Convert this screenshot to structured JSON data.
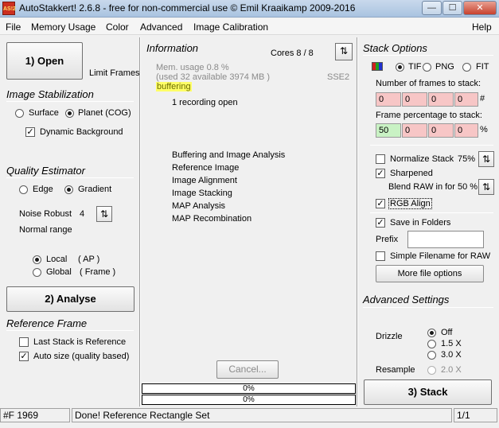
{
  "window": {
    "app_icon_text": "AS!2",
    "title": "AutoStakkert! 2.6.8 - free for non-commercial use © Emil Kraaikamp 2009-2016",
    "min_glyph": "—",
    "max_glyph": "☐",
    "close_glyph": "✕"
  },
  "menu": [
    "File",
    "Memory Usage",
    "Color",
    "Advanced",
    "Image Calibration",
    "Help"
  ],
  "left": {
    "open_label": "1) Open",
    "limit_frames": "Limit Frames",
    "stabilization_title": "Image Stabilization",
    "surface_label": "Surface",
    "planet_label": "Planet (COG)",
    "dynamic_bg_label": "Dynamic Background",
    "quality_title": "Quality Estimator",
    "edge_label": "Edge",
    "gradient_label": "Gradient",
    "noise_robust_label": "Noise Robust",
    "noise_robust_value": "4",
    "normal_range": "Normal range",
    "local_label": "Local",
    "local_ap": "( AP )",
    "global_label": "Global",
    "global_frame": "( Frame )",
    "analyse_label": "2) Analyse",
    "reference_title": "Reference Frame",
    "last_stack_label": "Last Stack is Reference",
    "auto_size_label": "Auto size (quality based)"
  },
  "middle": {
    "info_title": "Information",
    "cores": "Cores 8 / 8",
    "mem_usage": "Mem. usage 0.8 %",
    "mem_available": "(used 32 available 3974 MB )",
    "sse": "SSE2",
    "buffering": "buffering",
    "recording_open": "1 recording open",
    "steps": [
      "Buffering and Image Analysis",
      "Reference Image",
      "Image Alignment",
      "Image Stacking",
      "MAP Analysis",
      "MAP Recombination"
    ],
    "cancel_label": "Cancel...",
    "progress1": "0%",
    "progress2": "0%"
  },
  "right": {
    "stack_title": "Stack Options",
    "tif_label": "TIF",
    "png_label": "PNG",
    "fit_label": "FIT",
    "frames_label": "Number of frames to stack:",
    "frames_values": [
      "0",
      "0",
      "0",
      "0"
    ],
    "frames_suffix": "#",
    "pct_label": "Frame percentage to stack:",
    "pct_values": [
      "50",
      "0",
      "0",
      "0"
    ],
    "pct_suffix": "%",
    "normalize_label": "Normalize Stack",
    "normalize_value": "75%",
    "sharpened_label": "Sharpened",
    "blend_label": "Blend RAW in for",
    "blend_value": "50 %",
    "rgb_align_label": "RGB Align",
    "save_folders_label": "Save in Folders",
    "prefix_label": "Prefix",
    "prefix_value": "",
    "simple_filename_label": "Simple Filename for RAW",
    "more_options_label": "More file options",
    "advanced_title": "Advanced Settings",
    "drizzle_label": "Drizzle",
    "drizzle_off": "Off",
    "drizzle_15": "1.5 X",
    "drizzle_30": "3.0 X",
    "resample_label": "Resample",
    "resample_value": "2.0 X",
    "stack_button": "3) Stack"
  },
  "status": {
    "frame": "#F 1969",
    "message": "Done! Reference Rectangle Set",
    "page": "1/1"
  }
}
